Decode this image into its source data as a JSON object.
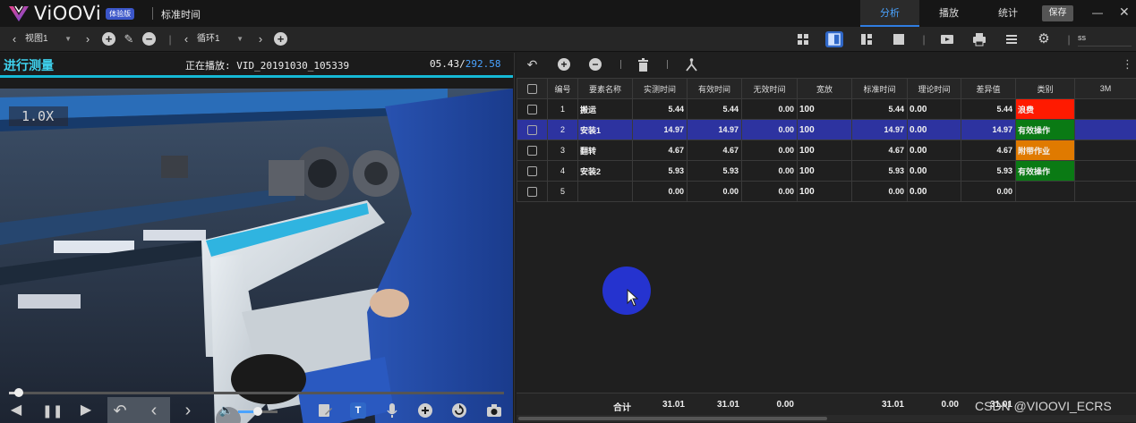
{
  "app": {
    "logo_text": "ViOOVi",
    "badge": "体验版",
    "title": "标准时间"
  },
  "top_tabs": [
    {
      "label": "分析",
      "active": true
    },
    {
      "label": "播放",
      "active": false
    },
    {
      "label": "统计",
      "active": false
    }
  ],
  "save_label": "保存",
  "toolbar": {
    "view_select": "视图1",
    "loop_select": "循环1",
    "ss_select": "ss",
    "accent": "#2f67c7"
  },
  "video": {
    "header_title": "进行测量",
    "now_playing_label": "正在播放: VID_20191030_105339",
    "current_time": "05.43/",
    "total_time": "292.58",
    "speed": "1.0X",
    "progress_fraction": 0.019,
    "volume_fraction": 0.5
  },
  "table": {
    "headers": [
      "",
      "编号",
      "要素名称",
      "实测时间",
      "有效时间",
      "无效时间",
      "宽放",
      "标准时间",
      "理论时间",
      "差异值",
      "类别",
      "3M"
    ],
    "rows": [
      {
        "no": "1",
        "name": "搬运",
        "measured": "5.44",
        "effective": "5.44",
        "invalid": "0.00",
        "allowance": "100",
        "standard": "5.44",
        "theory": "0.00",
        "diff": "5.44",
        "category": "浪费",
        "cat_color": "#ff1a00",
        "selected": false
      },
      {
        "no": "2",
        "name": "安装1",
        "measured": "14.97",
        "effective": "14.97",
        "invalid": "0.00",
        "allowance": "100",
        "standard": "14.97",
        "theory": "0.00",
        "diff": "14.97",
        "category": "有效操作",
        "cat_color": "#0a7a14",
        "selected": true
      },
      {
        "no": "3",
        "name": "翻转",
        "measured": "4.67",
        "effective": "4.67",
        "invalid": "0.00",
        "allowance": "100",
        "standard": "4.67",
        "theory": "0.00",
        "diff": "4.67",
        "category": "附带作业",
        "cat_color": "#e07a00",
        "selected": false
      },
      {
        "no": "4",
        "name": "安装2",
        "measured": "5.93",
        "effective": "5.93",
        "invalid": "0.00",
        "allowance": "100",
        "standard": "5.93",
        "theory": "0.00",
        "diff": "5.93",
        "category": "有效操作",
        "cat_color": "#0a7a14",
        "selected": false
      },
      {
        "no": "5",
        "name": "",
        "measured": "0.00",
        "effective": "0.00",
        "invalid": "0.00",
        "allowance": "100",
        "standard": "0.00",
        "theory": "0.00",
        "diff": "0.00",
        "category": "",
        "cat_color": "",
        "selected": false
      }
    ],
    "footer": {
      "label": "合计",
      "measured": "31.01",
      "effective": "31.01",
      "invalid": "0.00",
      "standard": "31.01",
      "theory": "0.00",
      "diff": "31.01"
    }
  },
  "watermark": "CSDN @VIOOVI_ECRS"
}
